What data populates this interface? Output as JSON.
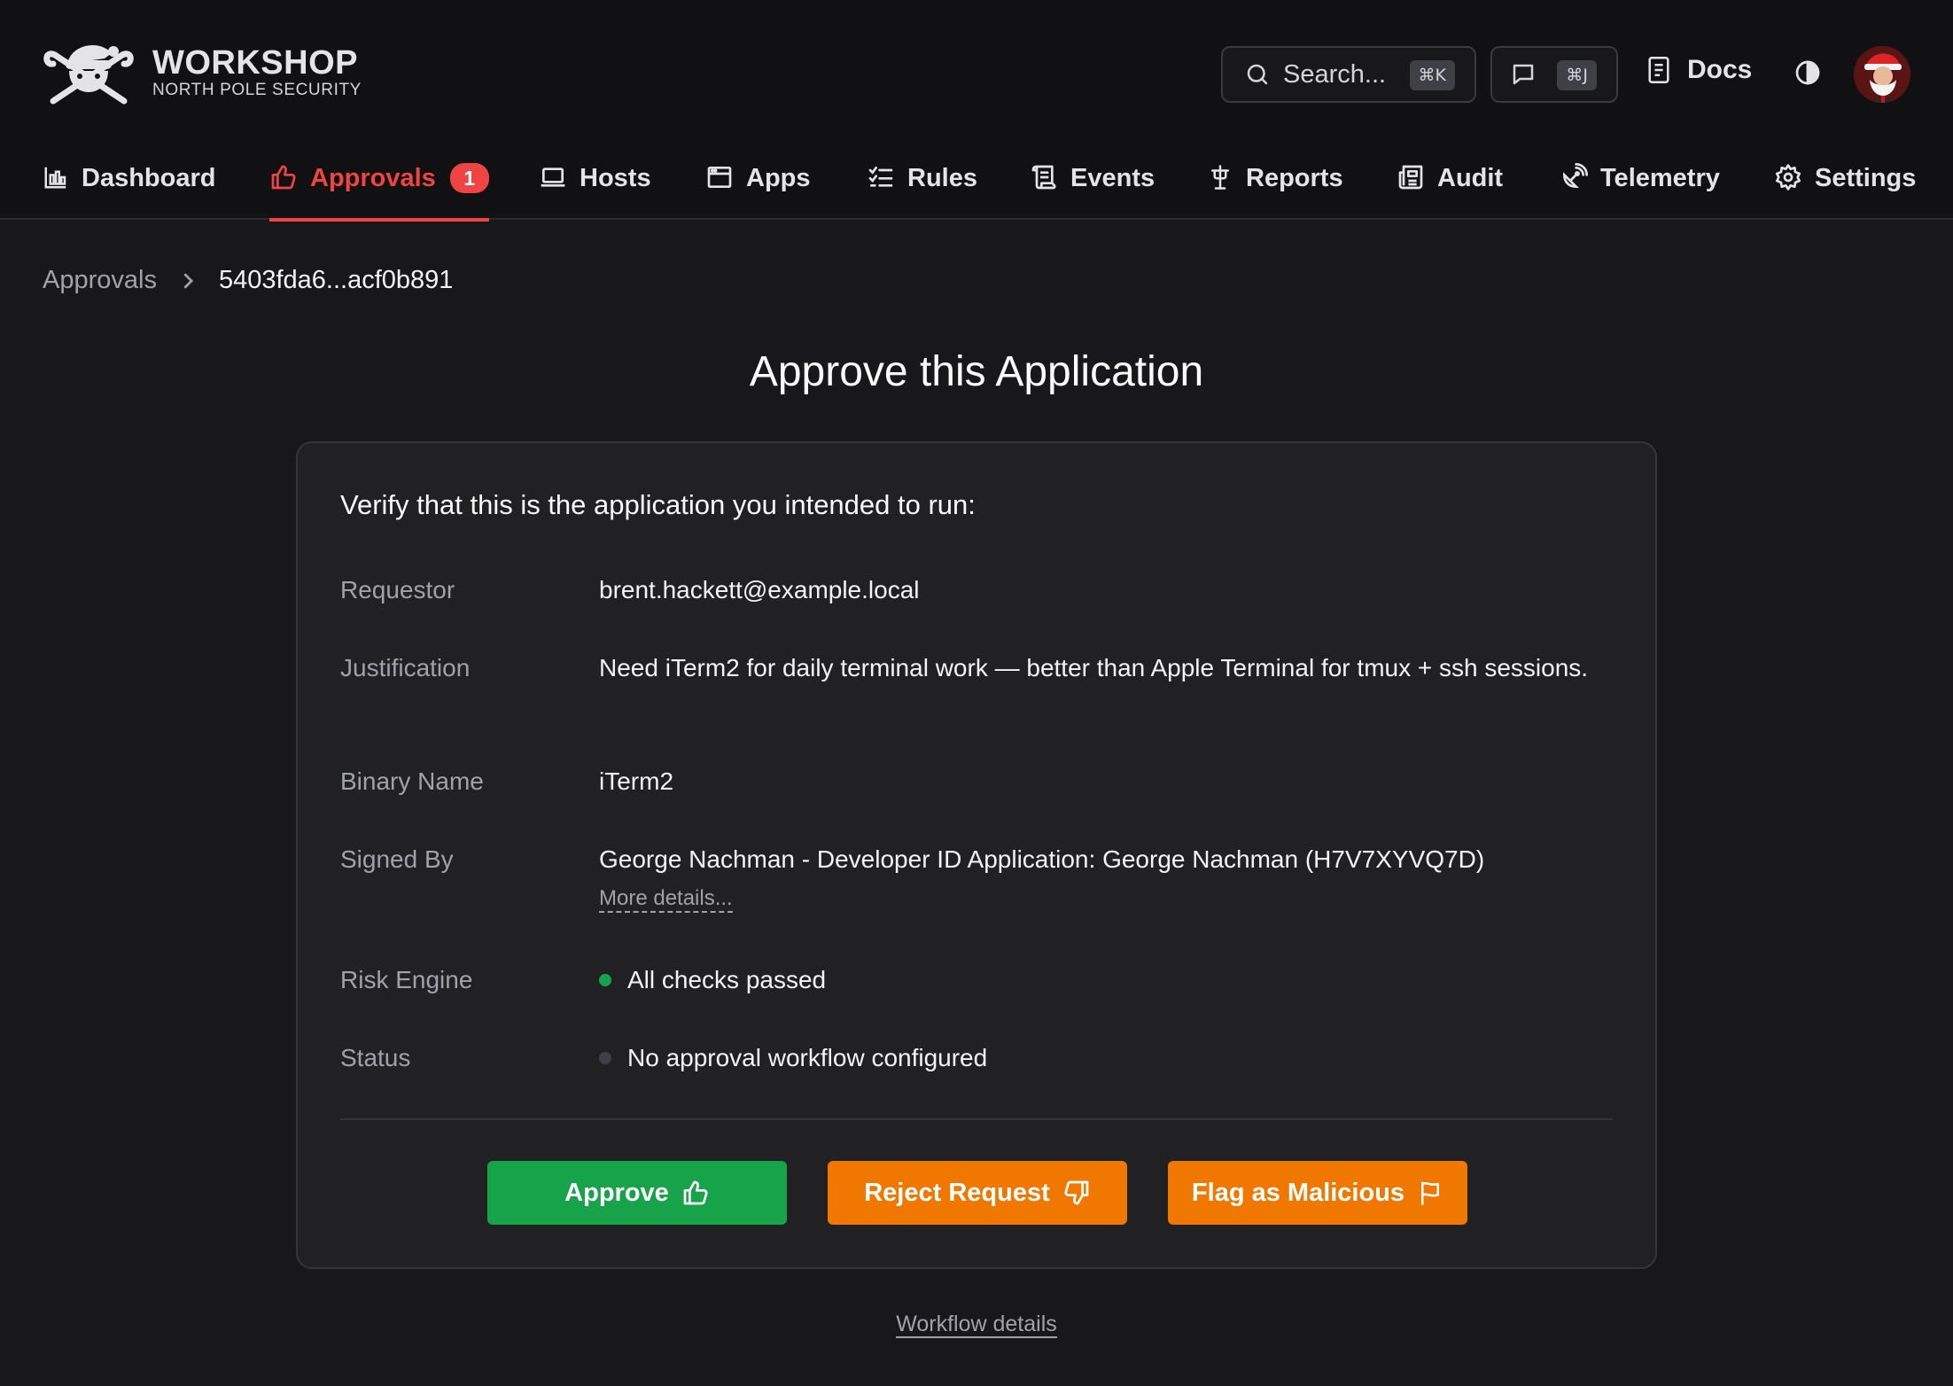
{
  "brand": {
    "title": "WORKSHOP",
    "subtitle": "NORTH POLE SECURITY"
  },
  "header": {
    "search": {
      "label": "Search...",
      "shortcut": "⌘K"
    },
    "chat": {
      "shortcut": "⌘J"
    },
    "docs_label": "Docs"
  },
  "nav": {
    "items": [
      {
        "label": "Dashboard",
        "icon": "bar-chart-icon"
      },
      {
        "label": "Approvals",
        "icon": "thumbs-up-icon",
        "badge": "1",
        "active": true
      },
      {
        "label": "Hosts",
        "icon": "laptop-icon"
      },
      {
        "label": "Apps",
        "icon": "window-icon"
      },
      {
        "label": "Rules",
        "icon": "checklist-icon"
      },
      {
        "label": "Events",
        "icon": "scroll-icon"
      },
      {
        "label": "Reports",
        "icon": "pin-icon"
      },
      {
        "label": "Audit",
        "icon": "newspaper-icon"
      },
      {
        "label": "Telemetry",
        "icon": "satellite-icon"
      },
      {
        "label": "Settings",
        "icon": "gear-icon"
      }
    ]
  },
  "breadcrumb": {
    "parent": "Approvals",
    "current": "5403fda6...acf0b891"
  },
  "page": {
    "title": "Approve this Application"
  },
  "card": {
    "heading": "Verify that this is the application you intended to run:",
    "requestor": {
      "label": "Requestor",
      "value": "brent.hackett@example.local"
    },
    "justification": {
      "label": "Justification",
      "value": "Need iTerm2 for daily terminal work — better than Apple Terminal for tmux + ssh sessions."
    },
    "binary_name": {
      "label": "Binary Name",
      "value": "iTerm2"
    },
    "signed_by": {
      "label": "Signed By",
      "value": "George Nachman - Developer ID Application: George Nachman (H7V7XYVQ7D)",
      "more_link": "More details..."
    },
    "risk_engine": {
      "label": "Risk Engine",
      "value": "All checks passed",
      "status_color": "#16a34a"
    },
    "status": {
      "label": "Status",
      "value": "No approval workflow configured",
      "status_color": "#3f3f46"
    }
  },
  "actions": {
    "approve_label": "Approve",
    "reject_label": "Reject Request",
    "flag_label": "Flag as Malicious"
  },
  "footer": {
    "workflow_link": "Workflow details"
  },
  "colors": {
    "accent": "#ef4444",
    "approve": "#16a34a",
    "warning": "#f07800"
  }
}
